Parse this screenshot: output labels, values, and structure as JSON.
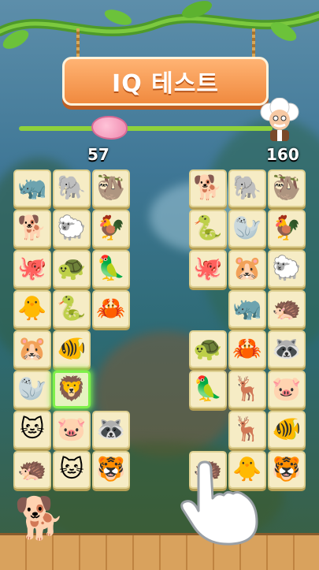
{
  "title": "IQ 테스트",
  "progress": {
    "current": "57",
    "target": "160",
    "fraction": 0.356
  },
  "icons": {
    "progress_marker": "brain-icon",
    "target_avatar": "einstein-icon",
    "mascot": "dog-icon",
    "pointer": "pointing-hand-icon"
  },
  "colors": {
    "sign": "#f08a3f",
    "progress": "#8ed13c",
    "selected": "#7ef04a",
    "tile": "#f6ecc5"
  },
  "board": {
    "selected_tile": "lion",
    "left_tiles": [
      {
        "animal": "rhino",
        "glyph": "🦏"
      },
      {
        "animal": "elephant",
        "glyph": "🐘"
      },
      {
        "animal": "sloth",
        "glyph": "🦥"
      },
      {
        "animal": "shiba",
        "glyph": "🐕"
      },
      {
        "animal": "sheep",
        "glyph": "🐑"
      },
      {
        "animal": "rooster",
        "glyph": "🐓"
      },
      {
        "animal": "octopus",
        "glyph": "🐙"
      },
      {
        "animal": "turtle",
        "glyph": "🐢"
      },
      {
        "animal": "parrot",
        "glyph": "🦜"
      },
      {
        "animal": "duckling",
        "glyph": "🐥"
      },
      {
        "animal": "snake",
        "glyph": "🐍"
      },
      {
        "animal": "crab",
        "glyph": "🦀"
      },
      {
        "animal": "hamster",
        "glyph": "🐹"
      },
      {
        "animal": "clownfish",
        "glyph": "🐠"
      },
      {
        "animal": "seal",
        "glyph": "🦭"
      },
      {
        "animal": "lion",
        "glyph": "🦁"
      },
      {
        "animal": "cat",
        "glyph": "🐱"
      },
      {
        "animal": "pig",
        "glyph": "🐷"
      },
      {
        "animal": "raccoon",
        "glyph": "🦝"
      },
      {
        "animal": "hedgehog",
        "glyph": "🦔"
      },
      {
        "animal": "cat",
        "glyph": "🐱"
      },
      {
        "animal": "tiger",
        "glyph": "🐯"
      }
    ],
    "right_tiles": [
      {
        "animal": "shiba",
        "glyph": "🐕"
      },
      {
        "animal": "elephant",
        "glyph": "🐘"
      },
      {
        "animal": "sloth",
        "glyph": "🦥"
      },
      {
        "animal": "snake",
        "glyph": "🐍"
      },
      {
        "animal": "seal",
        "glyph": "🦭"
      },
      {
        "animal": "rooster",
        "glyph": "🐓"
      },
      {
        "animal": "octopus",
        "glyph": "🐙"
      },
      {
        "animal": "hamster",
        "glyph": "🐹"
      },
      {
        "animal": "sheep",
        "glyph": "🐑"
      },
      {
        "animal": "rhino",
        "glyph": "🦏"
      },
      {
        "animal": "hedgehog",
        "glyph": "🦔"
      },
      {
        "animal": "turtle",
        "glyph": "🐢"
      },
      {
        "animal": "crab",
        "glyph": "🦀"
      },
      {
        "animal": "raccoon",
        "glyph": "🦝"
      },
      {
        "animal": "parrot",
        "glyph": "🦜"
      },
      {
        "animal": "deer",
        "glyph": "🦌"
      },
      {
        "animal": "pig",
        "glyph": "🐷"
      },
      {
        "animal": "deer",
        "glyph": "🦌"
      },
      {
        "animal": "clownfish",
        "glyph": "🐠"
      },
      {
        "animal": "hedgehog",
        "glyph": "🦔"
      },
      {
        "animal": "duckling",
        "glyph": "🐥"
      },
      {
        "animal": "tiger",
        "glyph": "🐯"
      }
    ]
  }
}
